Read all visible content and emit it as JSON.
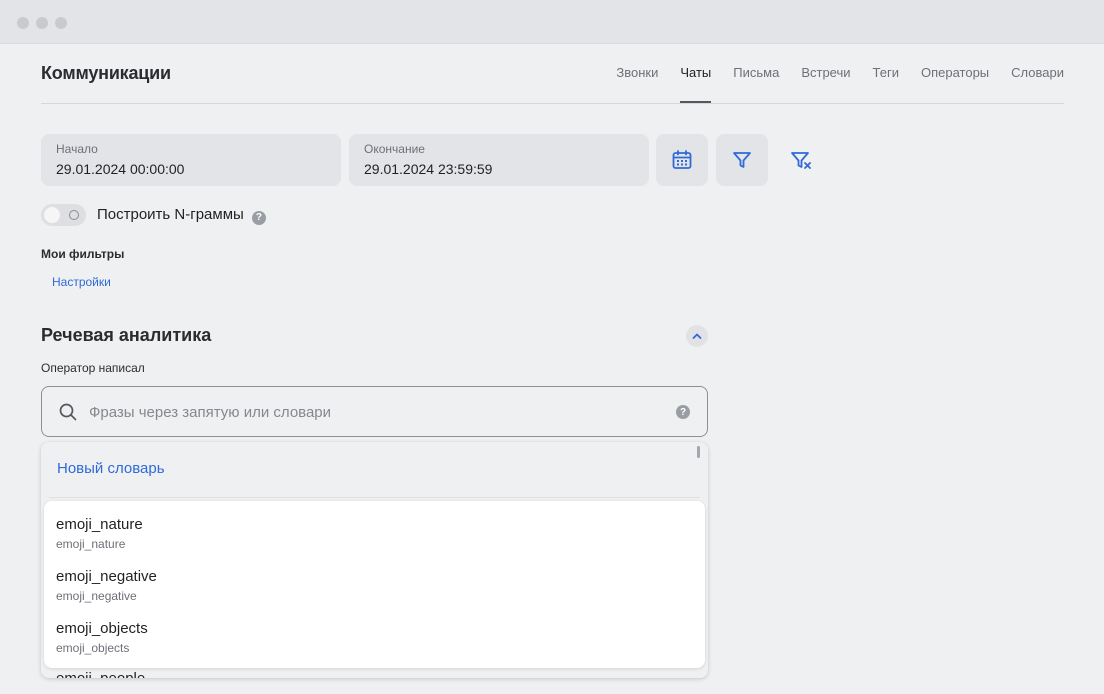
{
  "window": {
    "controls": [
      "close",
      "minimize",
      "zoom"
    ]
  },
  "header": {
    "title": "Коммуникации",
    "tabs": [
      {
        "label": "Звонки"
      },
      {
        "label": "Чаты"
      },
      {
        "label": "Письма"
      },
      {
        "label": "Встречи"
      },
      {
        "label": "Теги"
      },
      {
        "label": "Операторы"
      },
      {
        "label": "Словари"
      }
    ],
    "active_tab": "Чаты"
  },
  "date_range": {
    "start_label": "Начало",
    "start_value": "29.01.2024 00:00:00",
    "end_label": "Окончание",
    "end_value": "29.01.2024 23:59:59"
  },
  "toolbar_icons": [
    "calendar-icon",
    "filter-icon",
    "clear-filter-icon"
  ],
  "ngram_toggle": {
    "label": "Построить N-граммы",
    "enabled": false,
    "help": "?"
  },
  "my_filters": {
    "title": "Мои фильтры",
    "settings_link": "Настройки"
  },
  "speech_analytics": {
    "title": "Речевая аналитика",
    "operator_label": "Оператор написал",
    "search_placeholder": "Фразы через запятую или словари",
    "help": "?"
  },
  "dropdown": {
    "new_dictionary": "Новый словарь",
    "items": [
      {
        "name": "emoji_nature",
        "sub": "emoji_nature"
      },
      {
        "name": "emoji_negative",
        "sub": "emoji_negative"
      },
      {
        "name": "emoji_objects",
        "sub": "emoji_objects"
      }
    ],
    "next_partial": "emoji_people"
  },
  "colors": {
    "accent": "#2f6ad6",
    "background": "#eff0f2",
    "panel": "#e3e4e7",
    "text": "#1f2124"
  }
}
